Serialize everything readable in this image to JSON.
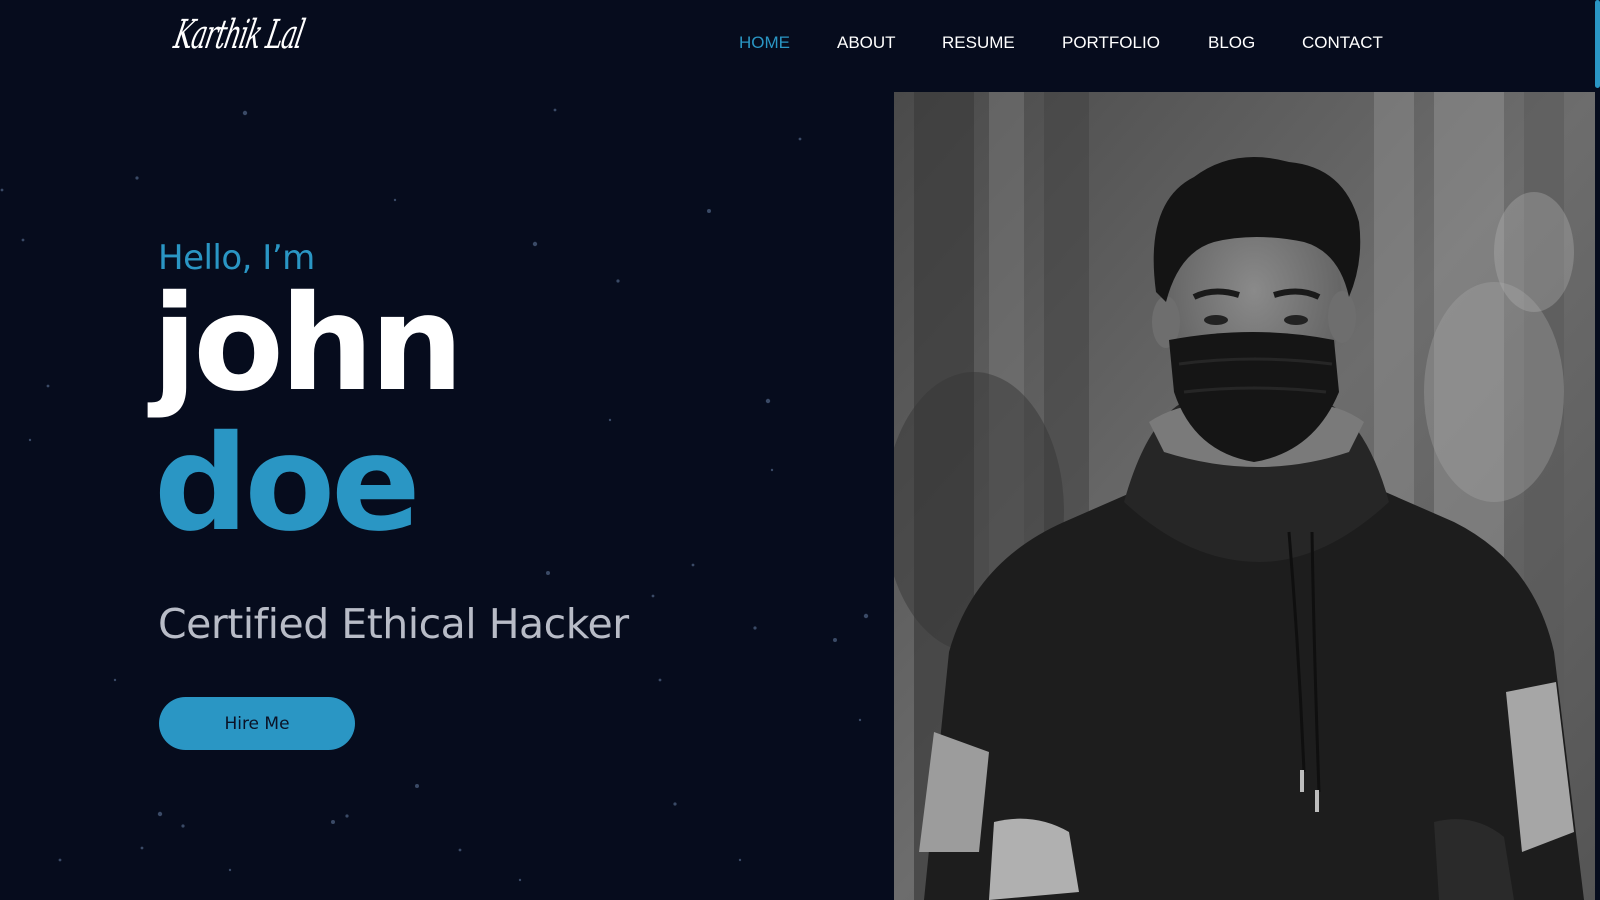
{
  "header": {
    "logo_text": "Karthik Lal",
    "nav": [
      {
        "label": "HOME",
        "active": true
      },
      {
        "label": "ABOUT",
        "active": false
      },
      {
        "label": "RESUME",
        "active": false
      },
      {
        "label": "PORTFOLIO",
        "active": false
      },
      {
        "label": "BLOG",
        "active": false
      },
      {
        "label": "CONTACT",
        "active": false
      }
    ]
  },
  "hero": {
    "greeting": "Hello, I’m",
    "first_name": "john",
    "last_name": "doe",
    "role": "Certified Ethical Hacker",
    "cta_label": "Hire Me"
  },
  "colors": {
    "background": "#060c1d",
    "accent": "#2a96c4",
    "text": "#ffffff",
    "muted_text": "#b8bcc7"
  },
  "icons": {
    "background_decoration": "starfield",
    "hero_image": "portrait-photo"
  }
}
